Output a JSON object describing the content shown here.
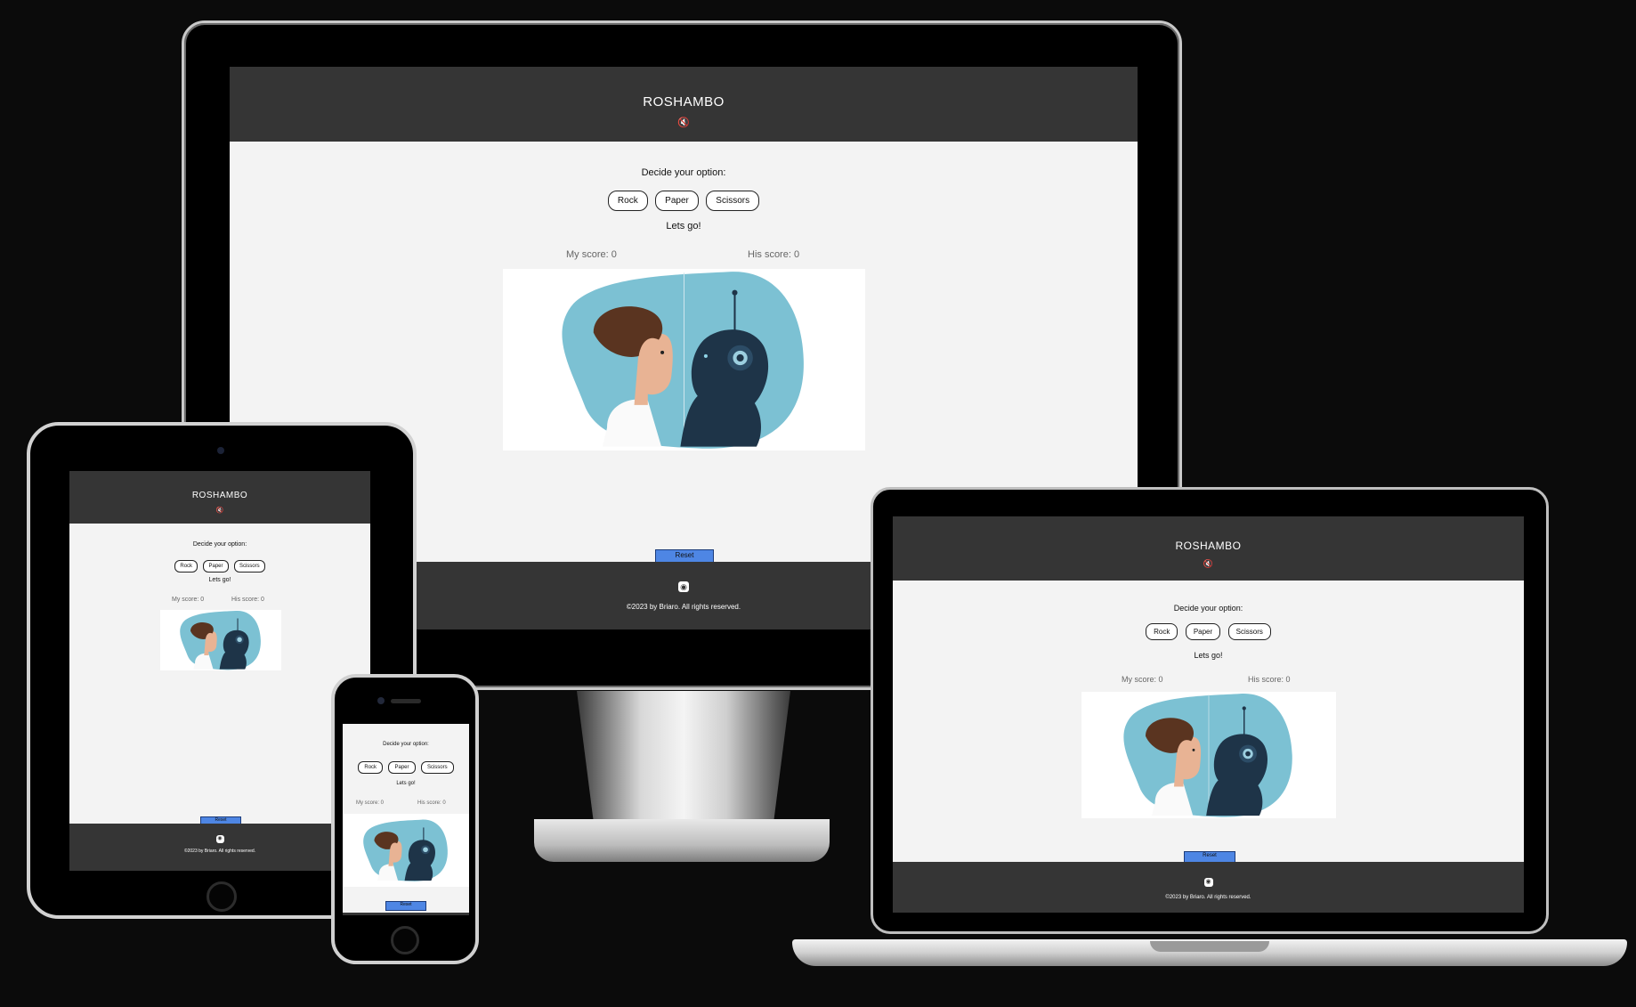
{
  "site": {
    "title": "ROSHAMBO",
    "mute_icon": "speaker-mute-icon",
    "prompt": "Decide your option:",
    "options": [
      "Rock",
      "Paper",
      "Scissors"
    ],
    "status": "Lets go!",
    "my_score_label": "My score: 0",
    "his_score_label": "His score: 0",
    "reset_label": "Reset",
    "github_icon": "github-icon",
    "copyright": "©2023 by Briaro. All rights reserved."
  },
  "colors": {
    "page_background": "#0b0b0b",
    "header_footer": "#353535",
    "content_background": "#f3f3f3",
    "reset_button": "#4e86e4",
    "illustration_blob": "#7cc1d3",
    "robot": "#1e3448",
    "hair": "#5a3420",
    "skin": "#e8b394"
  },
  "devices": [
    "desktop-monitor",
    "laptop",
    "tablet",
    "phone"
  ]
}
